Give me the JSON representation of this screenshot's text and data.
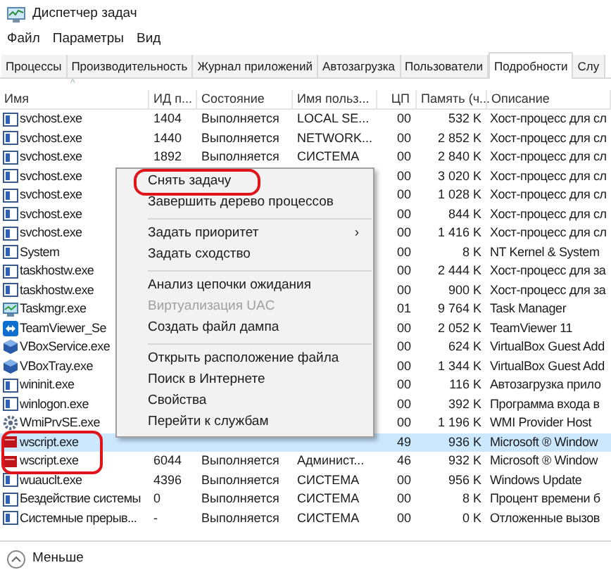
{
  "window": {
    "title": "Диспетчер задач"
  },
  "menu_bar": [
    "Файл",
    "Параметры",
    "Вид"
  ],
  "tabs": [
    {
      "label": "Процессы",
      "selected": false
    },
    {
      "label": "Производительность",
      "selected": false
    },
    {
      "label": "Журнал приложений",
      "selected": false
    },
    {
      "label": "Автозагрузка",
      "selected": false
    },
    {
      "label": "Пользователи",
      "selected": false
    },
    {
      "label": "Подробности",
      "selected": true
    },
    {
      "label": "Слу",
      "selected": false
    }
  ],
  "table": {
    "sort_indicator": "^",
    "columns": [
      "Имя",
      "ИД п...",
      "Состояние",
      "Имя польз...",
      "ЦП",
      "Память (ч...",
      "Описание"
    ],
    "rows": [
      {
        "kind": "window",
        "name": "svchost.exe",
        "pid": "1404",
        "status": "Выполняется",
        "user": "LOCAL SE...",
        "cpu": "00",
        "memory": "532 K",
        "description": "Хост-процесс для сл",
        "selected": false,
        "annotated": false
      },
      {
        "kind": "window",
        "name": "svchost.exe",
        "pid": "1440",
        "status": "Выполняется",
        "user": "NETWORK...",
        "cpu": "00",
        "memory": "2 852 K",
        "description": "Хост-процесс для сл",
        "selected": false,
        "annotated": false
      },
      {
        "kind": "window",
        "name": "svchost.exe",
        "pid": "1892",
        "status": "Выполняется",
        "user": "СИСТЕМА",
        "cpu": "00",
        "memory": "2 840 K",
        "description": "Хост-процесс для сл",
        "selected": false,
        "annotated": false
      },
      {
        "kind": "window",
        "name": "svchost.exe",
        "cpu": "00",
        "memory": "3 020 K",
        "description": "Хост-процесс для сл",
        "selected": false,
        "annotated": false
      },
      {
        "kind": "window",
        "name": "svchost.exe",
        "cpu": "00",
        "memory": "1 028 K",
        "description": "Хост-процесс для сл",
        "selected": false,
        "annotated": false
      },
      {
        "kind": "window",
        "name": "svchost.exe",
        "cpu": "00",
        "memory": "844 K",
        "description": "Хост-процесс для сл",
        "selected": false,
        "annotated": false
      },
      {
        "kind": "window",
        "name": "svchost.exe",
        "cpu": "00",
        "memory": "1 416 K",
        "description": "Хост-процесс для сл",
        "selected": false,
        "annotated": false
      },
      {
        "kind": "window",
        "name": "System",
        "cpu": "00",
        "memory": "8 K",
        "description": "NT Kernel & System",
        "selected": false,
        "annotated": false
      },
      {
        "kind": "window",
        "name": "taskhostw.exe",
        "cpu": "00",
        "memory": "2 444 K",
        "description": "Хост-процесс для за",
        "selected": false,
        "annotated": false
      },
      {
        "kind": "window",
        "name": "taskhostw.exe",
        "cpu": "00",
        "memory": "900 K",
        "description": "Хост-процесс для за",
        "selected": false,
        "annotated": false
      },
      {
        "kind": "monitor",
        "name": "Taskmgr.exe",
        "cpu": "01",
        "memory": "9 764 K",
        "description": "Task Manager",
        "selected": false,
        "annotated": false
      },
      {
        "kind": "arrows",
        "name": "TeamViewer_Se",
        "cpu": "00",
        "memory": "2 052 K",
        "description": "TeamViewer 11",
        "selected": false,
        "annotated": false
      },
      {
        "kind": "cube",
        "name": "VBoxService.exe",
        "cpu": "00",
        "memory": "624 K",
        "description": "VirtualBox Guest Add",
        "selected": false,
        "annotated": false
      },
      {
        "kind": "cube",
        "name": "VBoxTray.exe",
        "cpu": "00",
        "memory": "1 344 K",
        "description": "VirtualBox Guest Add",
        "selected": false,
        "annotated": false
      },
      {
        "kind": "window",
        "name": "wininit.exe",
        "cpu": "00",
        "memory": "116 K",
        "description": "Автозагрузка прило",
        "selected": false,
        "annotated": false
      },
      {
        "kind": "window",
        "name": "winlogon.exe",
        "cpu": "00",
        "memory": "392 K",
        "description": "Программа входа в",
        "selected": false,
        "annotated": false
      },
      {
        "kind": "gear",
        "name": "WmiPrvSE.exe",
        "cpu": "00",
        "memory": "1 196 K",
        "description": "WMI Provider Host",
        "selected": false,
        "annotated": false
      },
      {
        "kind": "script",
        "name": "wscript.exe",
        "cpu": "49",
        "memory": "936 K",
        "description": "Microsoft ® Window",
        "selected": true,
        "annotated": true
      },
      {
        "kind": "script",
        "name": "wscript.exe",
        "pid": "6044",
        "status": "Выполняется",
        "user": "Админист...",
        "cpu": "46",
        "memory": "932 K",
        "description": "Microsoft ® Window",
        "selected": false,
        "annotated": true
      },
      {
        "kind": "window",
        "name": "wuauclt.exe",
        "pid": "4396",
        "status": "Выполняется",
        "user": "СИСТЕМА",
        "cpu": "00",
        "memory": "956 K",
        "description": "Windows Update",
        "selected": false,
        "annotated": false
      },
      {
        "kind": "window",
        "name": "Бездействие системы",
        "pid": "0",
        "status": "Выполняется",
        "user": "СИСТЕМА",
        "cpu": "00",
        "memory": "8 K",
        "description": "Процент времени б",
        "selected": false,
        "annotated": false
      },
      {
        "kind": "window",
        "name": "Системные прерыв...",
        "pid": "-",
        "status": "Выполняется",
        "user": "СИСТЕМА",
        "cpu": "00",
        "memory": "0 K",
        "description": "Отложенные вызов",
        "selected": false,
        "annotated": false
      }
    ]
  },
  "context_menu": [
    {
      "kind": "item",
      "label": "Снять задачу",
      "disabled": false,
      "annotated": true
    },
    {
      "kind": "item",
      "label": "Завершить дерево процессов",
      "disabled": false,
      "annotated": false
    },
    {
      "kind": "separator"
    },
    {
      "kind": "submenu",
      "label": "Задать приоритет",
      "arrow": "›",
      "disabled": false,
      "annotated": false
    },
    {
      "kind": "item",
      "label": "Задать сходство",
      "disabled": false,
      "annotated": false
    },
    {
      "kind": "separator"
    },
    {
      "kind": "item",
      "label": "Анализ цепочки ожидания",
      "disabled": false,
      "annotated": false
    },
    {
      "kind": "item",
      "label": "Виртуализация UAC",
      "disabled": true,
      "annotated": false
    },
    {
      "kind": "item",
      "label": "Создать файл дампа",
      "disabled": false,
      "annotated": false
    },
    {
      "kind": "separator"
    },
    {
      "kind": "item",
      "label": "Открыть расположение файла",
      "disabled": false,
      "annotated": false
    },
    {
      "kind": "item",
      "label": "Поиск в Интернете",
      "disabled": false,
      "annotated": false
    },
    {
      "kind": "item",
      "label": "Свойства",
      "disabled": false,
      "annotated": false
    },
    {
      "kind": "item",
      "label": "Перейти к службам",
      "disabled": false,
      "annotated": false
    }
  ],
  "footer": {
    "toggle": "Меньше"
  }
}
